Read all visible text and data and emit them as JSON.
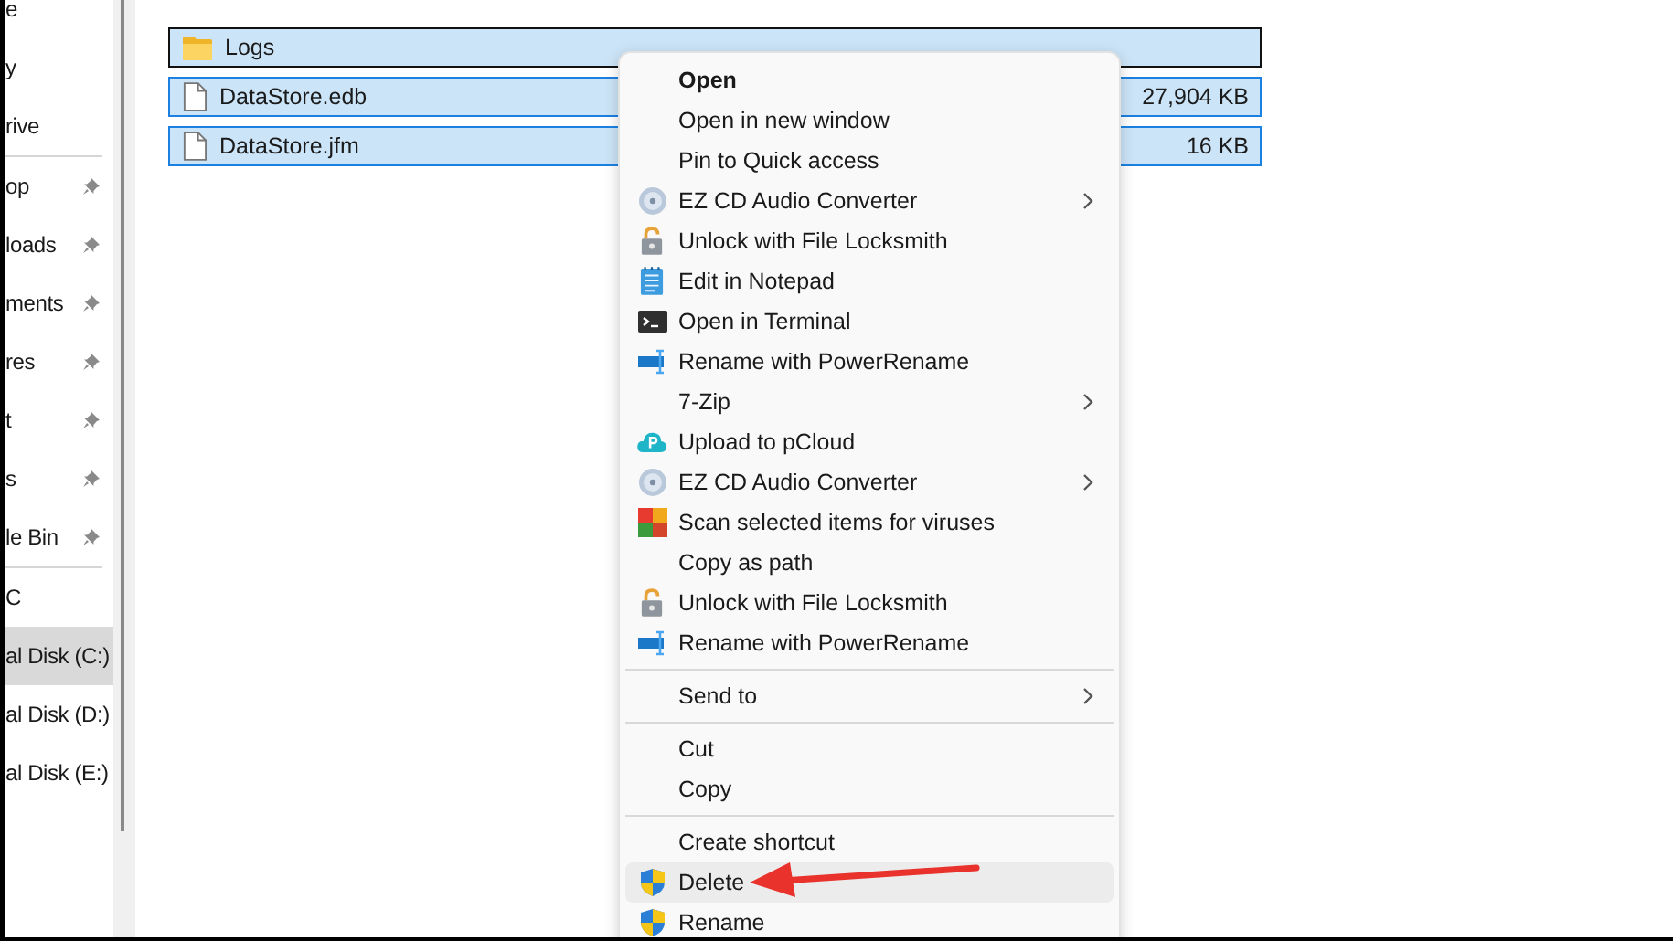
{
  "sidebar": {
    "sections": [
      {
        "items": [
          {
            "label": "e",
            "pinned": false,
            "selected": false
          },
          {
            "label": "y",
            "pinned": false,
            "selected": false
          },
          {
            "label": "rive",
            "pinned": false,
            "selected": false
          }
        ]
      },
      {
        "items": [
          {
            "label": "op",
            "pinned": true,
            "selected": false
          },
          {
            "label": "loads",
            "pinned": true,
            "selected": false
          },
          {
            "label": "ments",
            "pinned": true,
            "selected": false
          },
          {
            "label": "res",
            "pinned": true,
            "selected": false
          },
          {
            "label": "t",
            "pinned": true,
            "selected": false
          },
          {
            "label": "s",
            "pinned": true,
            "selected": false
          },
          {
            "label": "le Bin",
            "pinned": true,
            "selected": false
          }
        ]
      },
      {
        "items": [
          {
            "label": "C",
            "pinned": false,
            "selected": false
          },
          {
            "label": "al Disk (C:)",
            "pinned": false,
            "selected": true
          },
          {
            "label": "al Disk (D:)",
            "pinned": false,
            "selected": false
          },
          {
            "label": "al Disk (E:)",
            "pinned": false,
            "selected": false
          }
        ]
      }
    ]
  },
  "files": [
    {
      "kind": "folder",
      "name": "Logs",
      "selected": true,
      "focused": true
    },
    {
      "kind": "file",
      "name": "DataStore.edb",
      "size": "27,904 KB",
      "selected": true,
      "focused": false
    },
    {
      "kind": "file",
      "name": "DataStore.jfm",
      "size": "16 KB",
      "selected": true,
      "focused": false
    }
  ],
  "context_menu": {
    "groups": [
      {
        "items": [
          {
            "label": "Open",
            "kind": "none",
            "bold": true,
            "submenu": false,
            "highlighted": false
          },
          {
            "label": "Open in new window",
            "kind": "none",
            "bold": false,
            "submenu": false,
            "highlighted": false
          },
          {
            "label": "Pin to Quick access",
            "kind": "none",
            "bold": false,
            "submenu": false,
            "highlighted": false
          },
          {
            "label": "EZ CD Audio Converter",
            "kind": "disc",
            "bold": false,
            "submenu": true,
            "highlighted": false
          },
          {
            "label": "Unlock with File Locksmith",
            "kind": "lock",
            "bold": false,
            "submenu": false,
            "highlighted": false
          },
          {
            "label": "Edit in Notepad",
            "kind": "notepad",
            "bold": false,
            "submenu": false,
            "highlighted": false
          },
          {
            "label": "Open in Terminal",
            "kind": "terminal",
            "bold": false,
            "submenu": false,
            "highlighted": false
          },
          {
            "label": "Rename with PowerRename",
            "kind": "rename",
            "bold": false,
            "submenu": false,
            "highlighted": false
          },
          {
            "label": "7-Zip",
            "kind": "none",
            "bold": false,
            "submenu": true,
            "highlighted": false
          },
          {
            "label": "Upload to pCloud",
            "kind": "cloud",
            "bold": false,
            "submenu": false,
            "highlighted": false
          },
          {
            "label": "EZ CD Audio Converter",
            "kind": "disc",
            "bold": false,
            "submenu": true,
            "highlighted": false
          },
          {
            "label": "Scan selected items for viruses",
            "kind": "scan",
            "bold": false,
            "submenu": false,
            "highlighted": false
          },
          {
            "label": "Copy as path",
            "kind": "none",
            "bold": false,
            "submenu": false,
            "highlighted": false
          },
          {
            "label": "Unlock with File Locksmith",
            "kind": "lock",
            "bold": false,
            "submenu": false,
            "highlighted": false
          },
          {
            "label": "Rename with PowerRename",
            "kind": "rename",
            "bold": false,
            "submenu": false,
            "highlighted": false
          }
        ]
      },
      {
        "items": [
          {
            "label": "Send to",
            "kind": "none",
            "bold": false,
            "submenu": true,
            "highlighted": false
          }
        ]
      },
      {
        "items": [
          {
            "label": "Cut",
            "kind": "none",
            "bold": false,
            "submenu": false,
            "highlighted": false
          },
          {
            "label": "Copy",
            "kind": "none",
            "bold": false,
            "submenu": false,
            "highlighted": false
          }
        ]
      },
      {
        "items": [
          {
            "label": "Create shortcut",
            "kind": "none",
            "bold": false,
            "submenu": false,
            "highlighted": false
          },
          {
            "label": "Delete",
            "kind": "shield",
            "bold": false,
            "submenu": false,
            "highlighted": true
          },
          {
            "label": "Rename",
            "kind": "shield",
            "bold": false,
            "submenu": false,
            "highlighted": false
          }
        ]
      }
    ]
  }
}
